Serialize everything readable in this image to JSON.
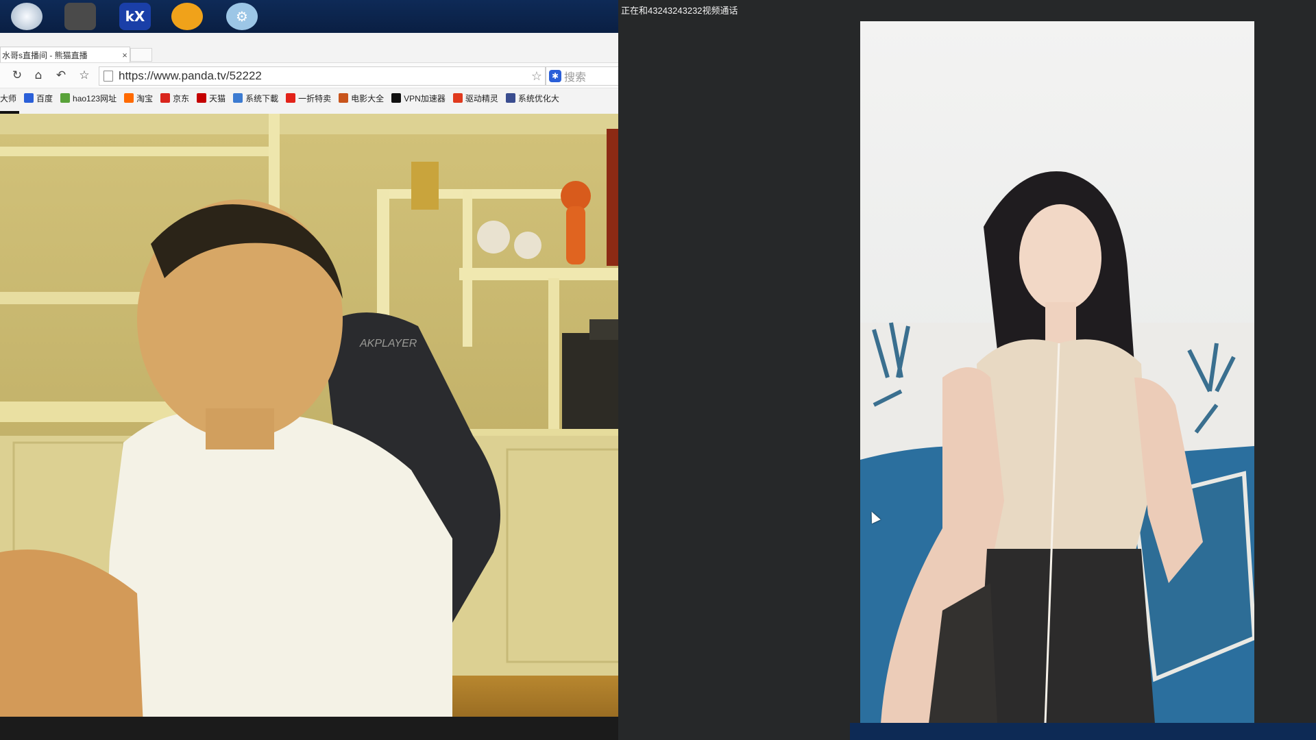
{
  "desktop": {
    "icons": [
      {
        "name": "disk-tool-icon",
        "color": "#dfe6ee"
      },
      {
        "name": "game-cat-icon",
        "color": "#3a3a3a"
      },
      {
        "name": "kx-icon",
        "color": "#1a3fa8",
        "label": "kX"
      },
      {
        "name": "cat-mascot-icon",
        "color": "#f0a21a"
      },
      {
        "name": "gear-app-icon",
        "color": "#9cc6e6"
      }
    ]
  },
  "browser": {
    "tab_title": "水哥s直播间 - 熊猫直播",
    "tab_close": "×",
    "url": "https://www.panda.tv/52222",
    "search_placeholder": "搜索",
    "bookmarks": [
      {
        "label": "大师",
        "color": "#ffffff"
      },
      {
        "label": "百度",
        "color": "#2a5fd8"
      },
      {
        "label": "hao123网址",
        "color": "#59a23a"
      },
      {
        "label": "淘宝",
        "color": "#ff6a00"
      },
      {
        "label": "京东",
        "color": "#d9251c"
      },
      {
        "label": "天猫",
        "color": "#c40000"
      },
      {
        "label": "系统下載",
        "color": "#3c7bd1"
      },
      {
        "label": "一折特卖",
        "color": "#e2231a"
      },
      {
        "label": "电影大全",
        "color": "#c8541c"
      },
      {
        "label": "VPN加速器",
        "color": "#111111"
      },
      {
        "label": "驱动精灵",
        "color": "#e03a1e"
      },
      {
        "label": "系统优化大",
        "color": "#3a4d8f"
      }
    ]
  },
  "call": {
    "title": "正在和43243243232视频通话"
  },
  "left_video": {
    "chair_brand": "AKPLAYER"
  },
  "colors": {
    "desktop_bg": "#0e2a57",
    "panel_bg": "#262829",
    "sofa_blue": "#2b6f9e"
  }
}
